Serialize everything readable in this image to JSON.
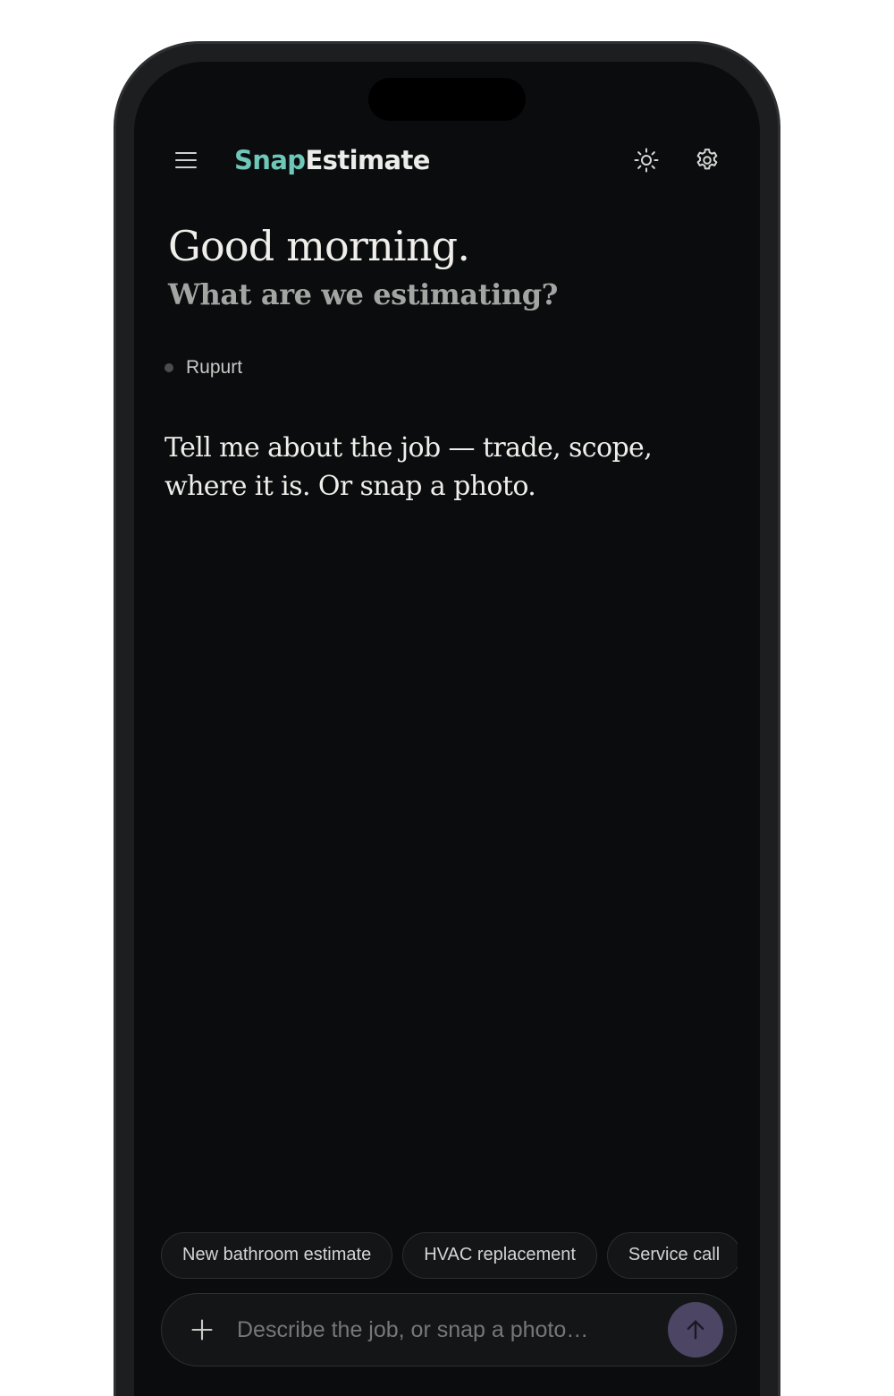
{
  "header": {
    "logo_part1": "Snap",
    "logo_part2": "Estimate",
    "menu_icon": "hamburger-menu-icon",
    "theme_icon": "sun-icon",
    "settings_icon": "gear-icon"
  },
  "greeting": {
    "title": "Good morning.",
    "subtitle": "What are we estimating?"
  },
  "project": {
    "name": "Rupurt"
  },
  "conversation": {
    "prompt": "Tell me about the job — trade, scope, where it is. Or snap a photo."
  },
  "suggestions": [
    "New bathroom estimate",
    "HVAC replacement",
    "Service call"
  ],
  "composer": {
    "placeholder": "Describe the job, or snap a photo…",
    "value": "",
    "add_icon": "plus-icon",
    "send_icon": "arrow-up-icon"
  },
  "colors": {
    "brand_accent": "#6ec7b8",
    "background": "#0b0c0e",
    "send_button": "#4c4563"
  }
}
